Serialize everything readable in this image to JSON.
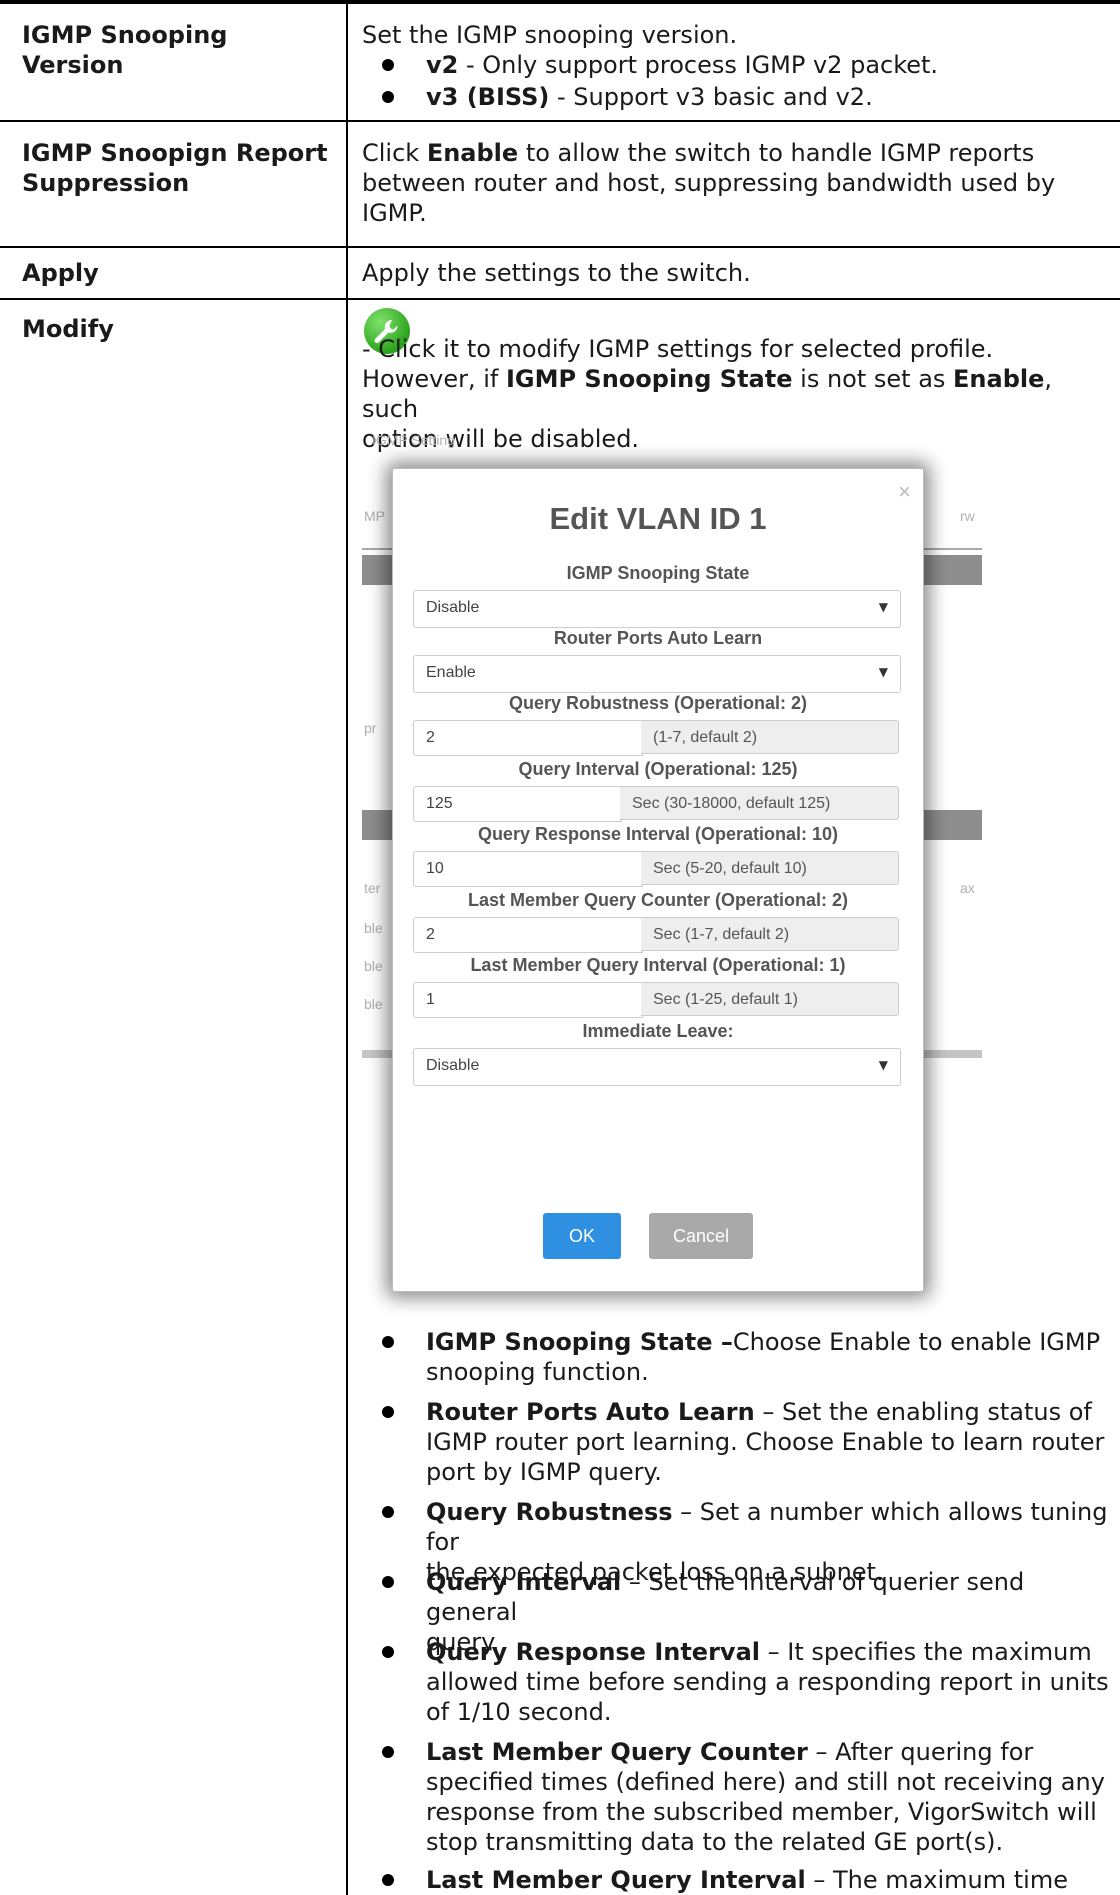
{
  "rows": [
    {
      "label": "IGMP Snooping Version",
      "intro": "Set the IGMP snooping version.",
      "bullets": [
        {
          "term": "v2",
          "text": " - Only support process IGMP v2 packet."
        },
        {
          "term": "v3 (BISS)",
          "text": " - Support v3 basic and v2."
        }
      ]
    },
    {
      "label_line1": "IGMP Snoopign Report",
      "label_line2": "Suppression",
      "line1_pre": "Click ",
      "line1_bold": "Enable",
      "line1_post": " to allow the switch to handle IGMP reports",
      "line2": "between router and host, suppressing bandwidth used by",
      "line3": "IGMP."
    },
    {
      "label": "Apply",
      "desc": "Apply the settings to the switch."
    },
    {
      "label": "Modify",
      "icon": "wrench-icon",
      "line1": "- Click it to modify IGMP settings for selected profile.",
      "line2_pre": "However, if ",
      "line2_bold1": "IGMP Snooping State",
      "line2_mid": " is not set as ",
      "line2_bold2": "Enable",
      "line2_post": ", such",
      "line3": "option will be disabled."
    }
  ],
  "dialog": {
    "close": "×",
    "title": "Edit VLAN ID 1",
    "fields": {
      "state_label": "IGMP Snooping State",
      "state_value": "Disable",
      "router_label": "Router Ports Auto Learn",
      "router_value": "Enable",
      "robust_label": "Query Robustness (Operational: 2)",
      "robust_value": "2",
      "robust_hint": "(1-7, default 2)",
      "interval_label": "Query Interval (Operational: 125)",
      "interval_value": "125",
      "interval_hint": "Sec (30-18000, default 125)",
      "resp_label": "Query Response Interval (Operational: 10)",
      "resp_value": "10",
      "resp_hint": "Sec (5-20, default 10)",
      "lmc_label": "Last Member Query Counter (Operational: 2)",
      "lmc_value": "2",
      "lmc_hint": "Sec (1-7, default 2)",
      "lmi_label": "Last Member Query Interval (Operational: 1)",
      "lmi_value": "1",
      "lmi_hint": "Sec (1-25, default 1)",
      "leave_label": "Immediate Leave:",
      "leave_value": "Disable"
    },
    "ok": "OK",
    "cancel": "Cancel",
    "background_fragments": {
      "tab": "IGMP Setting",
      "left1": "MP",
      "right1": "rw",
      "left2": "pr",
      "left3": "ter",
      "right3": "ax",
      "left4": "ble",
      "left5": "ble",
      "left6": "ble"
    }
  },
  "modify_bullets": [
    {
      "term": "IGMP Snooping State",
      "sep": " –",
      "lines": [
        "Choose Enable to enable IGMP",
        "snooping function."
      ]
    },
    {
      "term": "Router Ports Auto Learn",
      "sep": " – ",
      "lines": [
        "Set the enabling status of",
        "IGMP router port learning. Choose Enable to learn router",
        "port by IGMP query."
      ]
    },
    {
      "term": "Query Robustness",
      "sep": " – ",
      "lines": [
        "Set a number which allows tuning for",
        "the expected packet loss on a subnet."
      ]
    },
    {
      "term": "Query Interval",
      "sep": " – ",
      "lines": [
        "Set the interval of querier send general",
        "query."
      ]
    },
    {
      "term": "Query Response Interval",
      "sep": " – ",
      "lines": [
        "It specifies the maximum",
        "allowed time before sending a responding report in units",
        "of 1/10 second."
      ]
    },
    {
      "term": "Last Member Query Counter",
      "sep": " – ",
      "lines": [
        "After quering for",
        "specified times (defined here) and still not receiving any",
        "response from the subscribed member, VigorSwitch will",
        "stop transmitting data to the related GE port(s)."
      ]
    },
    {
      "term": "Last Member Query Interval",
      "sep": " – ",
      "lines": [
        "The maximum time"
      ]
    }
  ]
}
